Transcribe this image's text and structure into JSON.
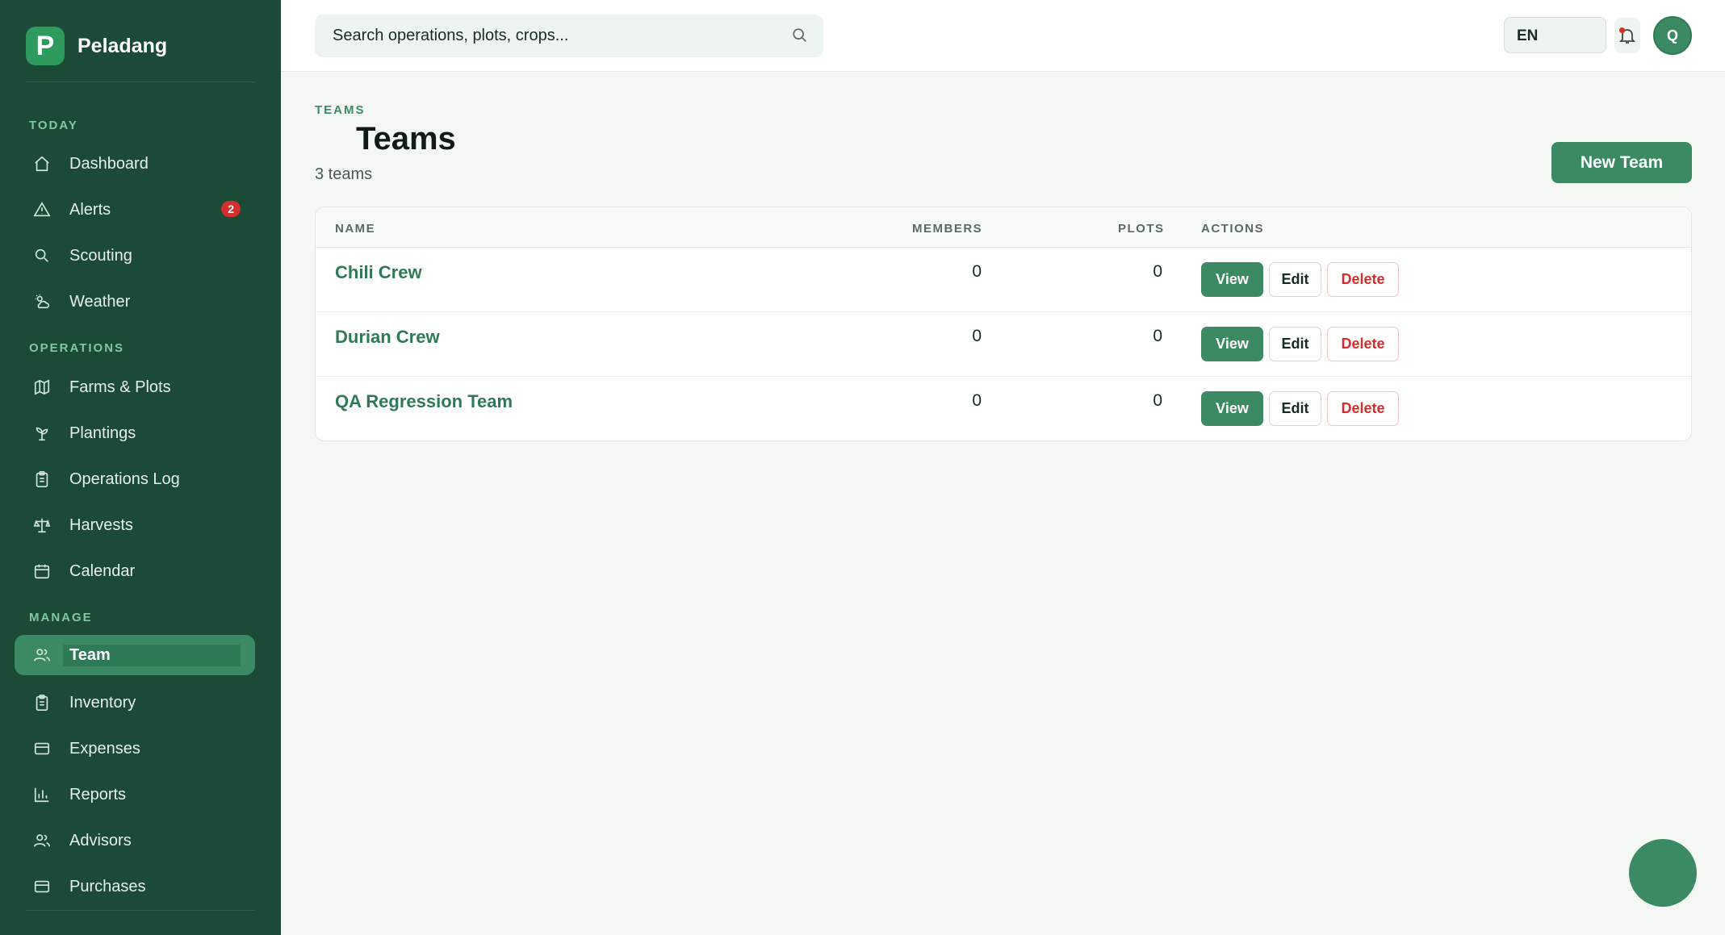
{
  "brand": {
    "initial": "P",
    "name": "Peladang"
  },
  "sidebar": {
    "sections": {
      "today": "TODAY",
      "operations": "OPERATIONS",
      "manage": "MANAGE"
    },
    "items": [
      {
        "label": "Dashboard",
        "icon": "home-icon"
      },
      {
        "label": "Alerts",
        "icon": "warning-icon",
        "badge": "2"
      },
      {
        "label": "Scouting",
        "icon": "search-icon"
      },
      {
        "label": "Weather",
        "icon": "weather-icon"
      },
      {
        "label": "Farms & Plots",
        "icon": "map-icon"
      },
      {
        "label": "Plantings",
        "icon": "sprout-icon"
      },
      {
        "label": "Operations Log",
        "icon": "clipboard-icon"
      },
      {
        "label": "Harvests",
        "icon": "scale-icon"
      },
      {
        "label": "Calendar",
        "icon": "calendar-icon"
      },
      {
        "label": "Team",
        "icon": "users-icon",
        "active": true
      },
      {
        "label": "Inventory",
        "icon": "clipboard-icon"
      },
      {
        "label": "Expenses",
        "icon": "card-icon"
      },
      {
        "label": "Reports",
        "icon": "bar-chart-icon"
      },
      {
        "label": "Advisors",
        "icon": "users-icon"
      },
      {
        "label": "Purchases",
        "icon": "card-icon"
      }
    ]
  },
  "topbar": {
    "search_placeholder": "Search operations, plots, crops...",
    "language": "EN",
    "avatar_initial": "Q"
  },
  "page": {
    "eyebrow": "TEAMS",
    "title": "Teams",
    "subtitle": "3 teams",
    "new_button": "New Team"
  },
  "table": {
    "headers": {
      "name": "NAME",
      "members": "MEMBERS",
      "plots": "PLOTS",
      "actions": "ACTIONS"
    },
    "rows": [
      {
        "name": "Chili Crew",
        "members": "0",
        "plots": "0"
      },
      {
        "name": "Durian Crew",
        "members": "0",
        "plots": "0"
      },
      {
        "name": "QA Regression Team",
        "members": "0",
        "plots": "0"
      }
    ],
    "actions": {
      "view": "View",
      "edit": "Edit",
      "delete": "Delete"
    }
  },
  "colors": {
    "sidebar_bg": "#1b4a36",
    "accent": "#3b8a64",
    "danger": "#d32f2f"
  }
}
